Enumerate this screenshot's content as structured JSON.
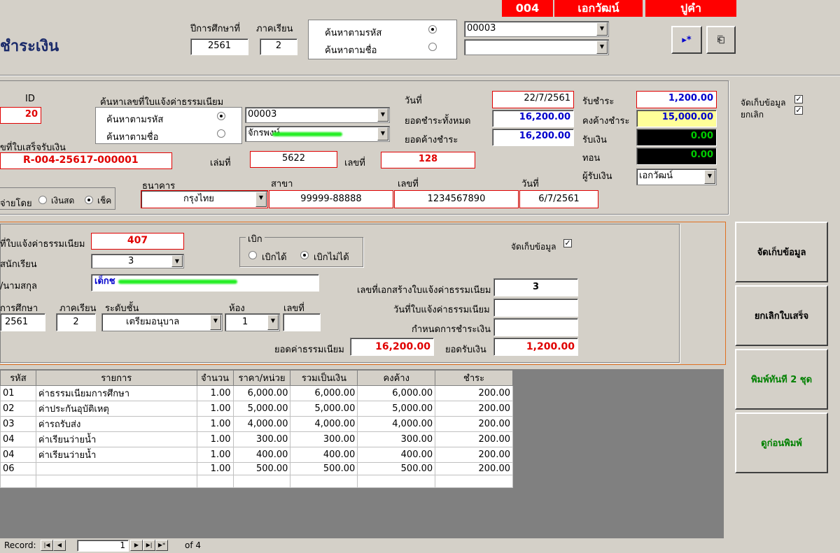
{
  "header": {
    "branch_code": "004",
    "user_name": "เอกวัฒน์",
    "extra": "ปูคำ",
    "page_title": "ชำระเงิน",
    "year_label": "ปีการศึกษาที่",
    "term_label": "ภาคเรียน",
    "year_value": "2561",
    "term_value": "2",
    "search_by_code_label": "ค้นหาตามรหัส",
    "search_by_name_label": "ค้นหาตามชื่อ",
    "search_code_value": "00003",
    "search_name_value": ""
  },
  "receipt": {
    "id_label": "ID",
    "id_value": "20",
    "search_invoice_label": "ค้นหาเลขที่ใบแจ้งค่าธรรมเนียม",
    "search_by_code_label": "ค้นหาตามรหัส",
    "search_by_name_label": "ค้นหาตามชื่อ",
    "code_value": "00003",
    "name_value": "จักรพงษ์",
    "receipt_no_label": "ขที่ใบเสร็จรับเงิน",
    "receipt_no_value": "R-004-25617-000001",
    "book_label": "เล่มที่",
    "book_value": "5622",
    "number_label": "เลขที่",
    "number_value": "128",
    "date_label": "วันที่",
    "date_value": "22/7/2561",
    "total_due_label": "ยอดชำระทั้งหมด",
    "total_due_value": "16,200.00",
    "outstanding_label": "ยอดค้างชำระ",
    "outstanding_value": "16,200.00",
    "receive_label": "รับชำระ",
    "receive_value": "1,200.00",
    "remain_label": "คงค้างชำระ",
    "remain_value": "15,000.00",
    "cash_in_label": "รับเงิน",
    "cash_in_value": "0.00",
    "change_label": "ทอน",
    "change_value": "0.00",
    "receiver_label": "ผู้รับเงิน",
    "receiver_value": "เอกวัฒน์",
    "save_data_label": "จัดเก็บข้อมูล",
    "cancel_label": "ยกเลิก",
    "pay_by_label": "จ่ายโดย",
    "cash_label": "เงินสด",
    "cheque_label": "เช็ค",
    "bank_label": "ธนาคาร",
    "bank_value": "กรุงไทย",
    "branch_label": "สาขา",
    "branch_value": "99999-88888",
    "cheque_no_label": "เลขที่",
    "cheque_no_value": "1234567890",
    "cheque_date_label": "วันที่",
    "cheque_date_value": "6/7/2561"
  },
  "invoice": {
    "invoice_no_label": "ที่ใบแจ้งค่าธรรมเนียม",
    "invoice_no_value": "407",
    "student_code_label": "สนักเรียน",
    "student_code_value": "3",
    "name_label": "/นามสกุล",
    "name_value": "เด็กช",
    "withdraw_label": "เบิก",
    "withdrawable_label": "เบิกได้",
    "not_withdrawable_label": "เบิกไม่ได้",
    "save_data_label": "จัดเก็บข้อมูล",
    "year_label": "การศึกษา",
    "term_label": "ภาคเรียน",
    "level_label": "ระดับชั้น",
    "room_label": "ห้อง",
    "no_label": "เลขที่",
    "year_value": "2561",
    "term_value": "2",
    "level_value": "เตรียมอนุบาล",
    "room_value": "1",
    "no_value": "",
    "doc_no_label": "เลขที่เอกสร้างใบแจ้งค่าธรรมเนียม",
    "doc_no_value": "3",
    "invoice_date_label": "วันที่ใบแจ้งค่าธรรมเนียม",
    "invoice_date_value": "",
    "due_label": "กำหนดการชำระเงิน",
    "due_value": "",
    "fee_total_label": "ยอดค่าธรรมเนียม",
    "fee_total_value": "16,200.00",
    "received_label": "ยอดรับเงิน",
    "received_value": "1,200.00"
  },
  "buttons": {
    "save": "จัดเก็บข้อมูล",
    "cancel_receipt": "ยกเลิกใบเสร็จ",
    "print_2": "พิมพ์ทันที 2 ชุด",
    "preview": "ดูก่อนพิมพ์"
  },
  "table": {
    "headers": [
      "รหัส",
      "รายการ",
      "จำนวน",
      "ราคา/หน่วย",
      "รวมเป็นเงิน",
      "คงค้าง",
      "ชำระ"
    ],
    "rows": [
      [
        "01",
        "ค่าธรรมเนียมการศึกษา",
        "1.00",
        "6,000.00",
        "6,000.00",
        "6,000.00",
        "200.00"
      ],
      [
        "02",
        "ค่าประกันอุบัติเหตุ",
        "1.00",
        "5,000.00",
        "5,000.00",
        "5,000.00",
        "200.00"
      ],
      [
        "03",
        "ค่ารถรับส่ง",
        "1.00",
        "4,000.00",
        "4,000.00",
        "4,000.00",
        "200.00"
      ],
      [
        "04",
        "ค่าเรียนว่ายน้ำ",
        "1.00",
        "300.00",
        "300.00",
        "300.00",
        "200.00"
      ],
      [
        "04",
        "ค่าเรียนว่ายน้ำ",
        "1.00",
        "400.00",
        "400.00",
        "400.00",
        "200.00"
      ],
      [
        "06",
        "",
        "1.00",
        "500.00",
        "500.00",
        "500.00",
        "200.00"
      ]
    ]
  },
  "record_nav": {
    "label": "Record:",
    "current": "1",
    "of_label": "of 4"
  }
}
